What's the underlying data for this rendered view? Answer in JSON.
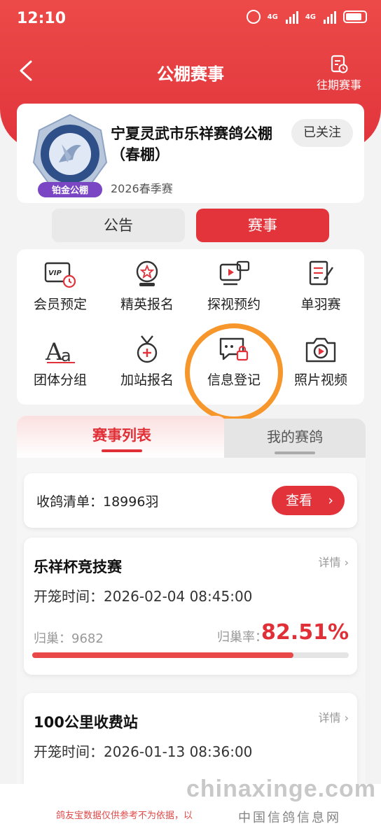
{
  "status_bar": {
    "time": "12:10",
    "net1": "4G",
    "net2": "4G"
  },
  "header": {
    "title": "公棚赛事",
    "history_label": "往期赛事"
  },
  "club": {
    "name": "宁夏灵武市乐祥赛鸽公棚（春棚）",
    "season": "2026春季赛",
    "follow_label": "已关注",
    "badge_text": "铂金公棚"
  },
  "top_tabs": [
    {
      "label": "公告"
    },
    {
      "label": "赛事"
    }
  ],
  "feature_grid": [
    {
      "label": "会员预定",
      "icon": "vip-card-icon"
    },
    {
      "label": "精英报名",
      "icon": "medal-badge-icon"
    },
    {
      "label": "探视预约",
      "icon": "video-camera-icon"
    },
    {
      "label": "单羽赛",
      "icon": "document-edit-icon"
    },
    {
      "label": "团体分组",
      "icon": "font-aa-icon"
    },
    {
      "label": "加站报名",
      "icon": "medal-plus-icon"
    },
    {
      "label": "信息登记",
      "icon": "chat-lock-icon"
    },
    {
      "label": "照片视频",
      "icon": "camera-play-icon"
    }
  ],
  "list_tabs": [
    {
      "label": "赛事列表"
    },
    {
      "label": "我的赛鸽"
    }
  ],
  "receive": {
    "label": "收鸽清单：18996羽",
    "button": "查看"
  },
  "races": [
    {
      "name": "乐祥杯竞技赛",
      "detail": "详情",
      "open_time": "开笼时间：2026-02-04 08:45:00",
      "home": "归巢：9682",
      "rate_label": "归巢率：",
      "rate": "82.51%",
      "progress": 0.8251
    },
    {
      "name": "100公里收费站",
      "detail": "详情",
      "open_time": "开笼时间：2026-01-13 08:36:00"
    }
  ],
  "footer": {
    "notice": "鸽友宝数据仅供参考不为依据，以"
  },
  "watermark": {
    "domain": "chinaxinge.com",
    "site": "中国信鸽信息网"
  },
  "colors": {
    "primary": "#e3343c",
    "highlight_ring": "#f7962a"
  }
}
